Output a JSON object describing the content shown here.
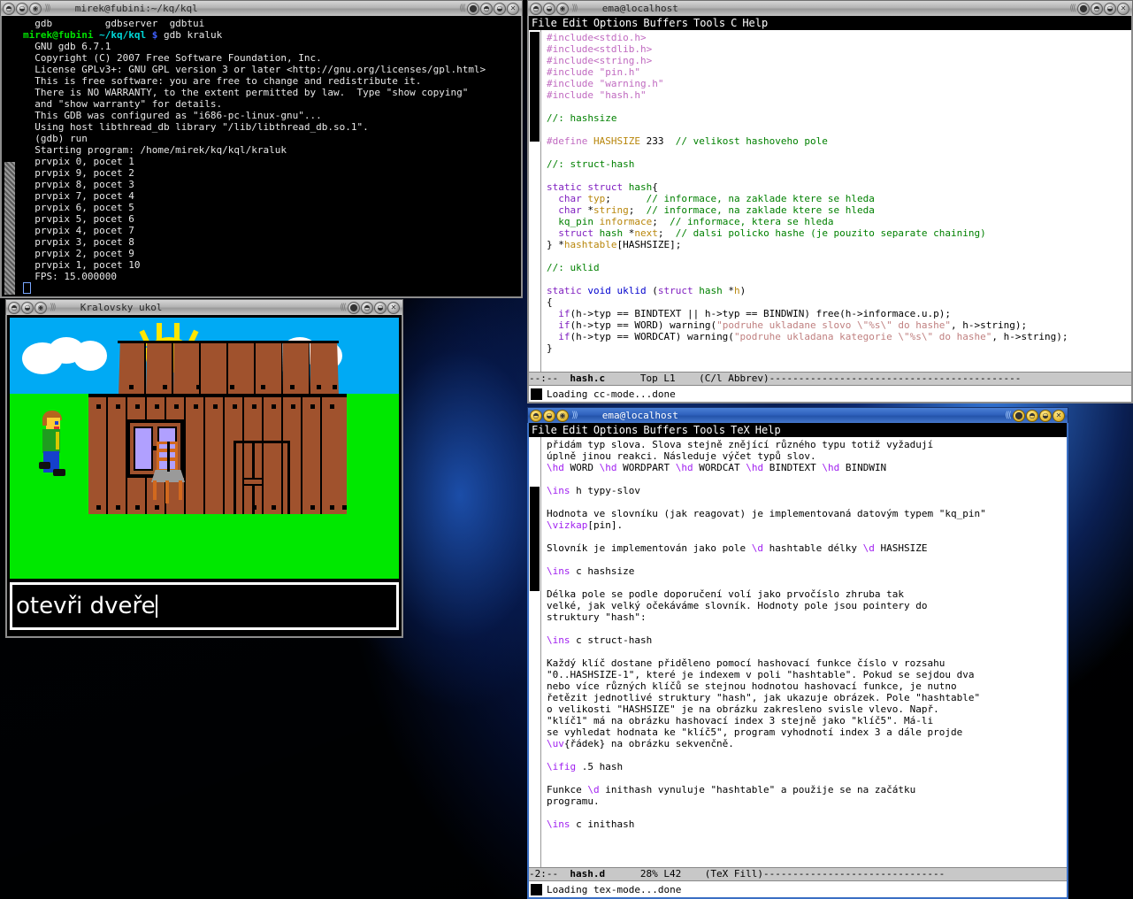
{
  "desktop": {
    "wallpaper_desc": "blue abstract fractal",
    "bg_color": "#02040d"
  },
  "windows": {
    "terminal": {
      "title": "mirek@fubini:~/kq/kql",
      "active": false,
      "buttons_left": [
        "shade-button",
        "minimize-button",
        "menu-button"
      ],
      "buttons_right": [
        "maximize-button",
        "iconify-button",
        "shade-button",
        "close-button"
      ],
      "lines": [
        "  gdb         gdbserver  gdbtui",
        "PROMPT",
        "  GNU gdb 6.7.1",
        "  Copyright (C) 2007 Free Software Foundation, Inc.",
        "  License GPLv3+: GNU GPL version 3 or later <http://gnu.org/licenses/gpl.html>",
        "  This is free software: you are free to change and redistribute it.",
        "  There is NO WARRANTY, to the extent permitted by law.  Type \"show copying\"",
        "  and \"show warranty\" for details.",
        "  This GDB was configured as \"i686-pc-linux-gnu\"...",
        "  Using host libthread_db library \"/lib/libthread_db.so.1\".",
        "  (gdb) run",
        "  Starting program: /home/mirek/kq/kql/kraluk",
        "  prvpix 0, pocet 1",
        "  prvpix 9, pocet 2",
        "  prvpix 8, pocet 3",
        "  prvpix 7, pocet 4",
        "  prvpix 6, pocet 5",
        "  prvpix 5, pocet 6",
        "  prvpix 4, pocet 7",
        "  prvpix 3, pocet 8",
        "  prvpix 2, pocet 9",
        "  prvpix 1, pocet 10",
        "  FPS: 15.000000"
      ],
      "prompt_user": "mirek@fubini",
      "prompt_path": "~/kq/kql",
      "prompt_sigil": "$",
      "prompt_command": "gdb kraluk"
    },
    "game": {
      "title": "Kralovsky ukol",
      "active": false,
      "input_text": "otevři dveře",
      "colors": {
        "sky": "#00aaf4",
        "grass": "#00e800",
        "house": "#a0522d",
        "window_glass": "#b0a0ff",
        "sun": "#ffe600"
      }
    },
    "emacs_c": {
      "title": "ema@localhost",
      "active": false,
      "menu": [
        "File",
        "Edit",
        "Options",
        "Buffers",
        "Tools",
        "C",
        "Help"
      ],
      "modeline": {
        "left": "--:--",
        "buffer": "hash.c",
        "pos": "Top L1",
        "mode": "(C/l Abbrev)",
        "dashes": "-------------------------------------------"
      },
      "minibuffer": "Loading cc-mode...done",
      "code": [
        {
          "t": "#include",
          "c": "pp",
          "rest": "<stdio.h>"
        },
        {
          "t": "#include",
          "c": "pp",
          "rest": "<stdlib.h>"
        },
        {
          "t": "#include",
          "c": "pp",
          "rest": "<string.h>"
        },
        {
          "t": "#include",
          "c": "pp",
          "rest": " \"pin.h\""
        },
        {
          "t": "#include",
          "c": "pp",
          "rest": " \"warning.h\""
        },
        {
          "t": "#include",
          "c": "pp",
          "rest": " \"hash.h\""
        }
      ]
    },
    "emacs_tex": {
      "title": "ema@localhost",
      "active": true,
      "menu": [
        "File",
        "Edit",
        "Options",
        "Buffers",
        "Tools",
        "TeX",
        "Help"
      ],
      "modeline": {
        "left": "-2:--",
        "buffer": "hash.d",
        "pos": "28% L42",
        "mode": "(TeX Fill)",
        "dashes": "-------------------------------"
      },
      "minibuffer": "Loading tex-mode...done"
    }
  }
}
